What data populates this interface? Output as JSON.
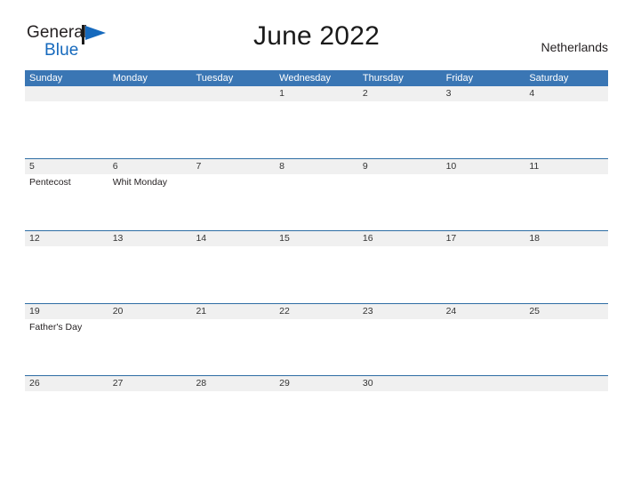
{
  "brand": {
    "name_part1": "General",
    "name_part2": "Blue",
    "flag_icon": "blue-flag-triangle",
    "accent_color": "#1569bd"
  },
  "header": {
    "title": "June 2022",
    "country": "Netherlands"
  },
  "theme": {
    "header_blue": "#3a76b4",
    "row_divider_blue": "#2e6da4",
    "date_band_gray": "#f0f0f0"
  },
  "weekdays": [
    "Sunday",
    "Monday",
    "Tuesday",
    "Wednesday",
    "Thursday",
    "Friday",
    "Saturday"
  ],
  "weeks": [
    {
      "days": [
        {
          "date": "",
          "event": ""
        },
        {
          "date": "",
          "event": ""
        },
        {
          "date": "",
          "event": ""
        },
        {
          "date": "1",
          "event": ""
        },
        {
          "date": "2",
          "event": ""
        },
        {
          "date": "3",
          "event": ""
        },
        {
          "date": "4",
          "event": ""
        }
      ]
    },
    {
      "days": [
        {
          "date": "5",
          "event": "Pentecost"
        },
        {
          "date": "6",
          "event": "Whit Monday"
        },
        {
          "date": "7",
          "event": ""
        },
        {
          "date": "8",
          "event": ""
        },
        {
          "date": "9",
          "event": ""
        },
        {
          "date": "10",
          "event": ""
        },
        {
          "date": "11",
          "event": ""
        }
      ]
    },
    {
      "days": [
        {
          "date": "12",
          "event": ""
        },
        {
          "date": "13",
          "event": ""
        },
        {
          "date": "14",
          "event": ""
        },
        {
          "date": "15",
          "event": ""
        },
        {
          "date": "16",
          "event": ""
        },
        {
          "date": "17",
          "event": ""
        },
        {
          "date": "18",
          "event": ""
        }
      ]
    },
    {
      "days": [
        {
          "date": "19",
          "event": "Father's Day"
        },
        {
          "date": "20",
          "event": ""
        },
        {
          "date": "21",
          "event": ""
        },
        {
          "date": "22",
          "event": ""
        },
        {
          "date": "23",
          "event": ""
        },
        {
          "date": "24",
          "event": ""
        },
        {
          "date": "25",
          "event": ""
        }
      ]
    },
    {
      "days": [
        {
          "date": "26",
          "event": ""
        },
        {
          "date": "27",
          "event": ""
        },
        {
          "date": "28",
          "event": ""
        },
        {
          "date": "29",
          "event": ""
        },
        {
          "date": "30",
          "event": ""
        },
        {
          "date": "",
          "event": ""
        },
        {
          "date": "",
          "event": ""
        }
      ]
    }
  ]
}
